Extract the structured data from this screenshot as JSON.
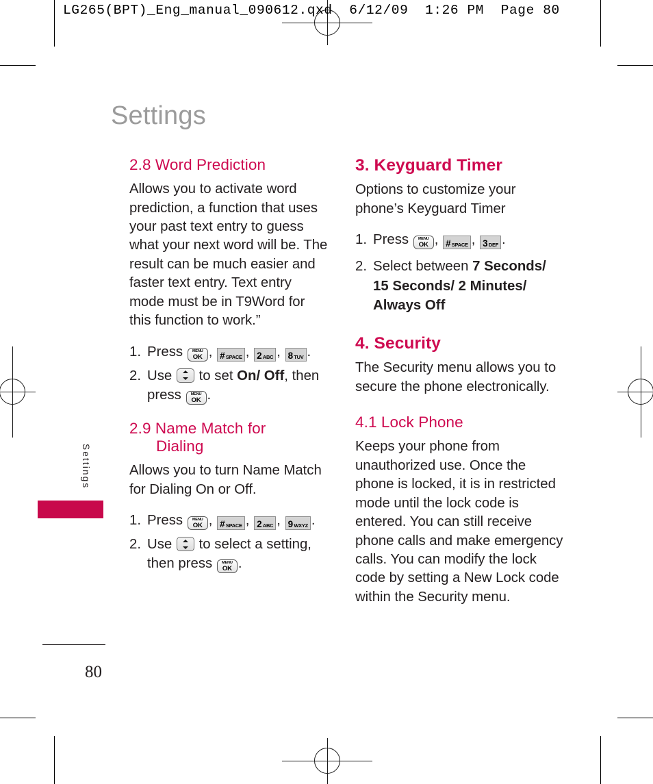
{
  "prepress": {
    "slug": "LG265(BPT)_Eng_manual_090612.qxd  6/12/09  1:26 PM  Page 80"
  },
  "page": {
    "title": "Settings",
    "side_tab_label": "Settings",
    "number": "80",
    "accent_color": "#ce0a50",
    "tab_color": "#c8094b",
    "title_color": "#9b9b9b"
  },
  "left_column": {
    "sections": [
      {
        "heading": "2.8 Word Prediction",
        "body": "Allows you to activate word prediction, a function that uses your past text entry to guess what your next word will be. The result can be much easier and faster text entry. Text entry mode must be in T9Word for this function to work.”",
        "steps": [
          {
            "num": "1.",
            "pre": "Press",
            "keys": [
              "MENU OK",
              "# SPACE",
              "2 ABC",
              "8 TUV"
            ],
            "post": "."
          },
          {
            "num": "2.",
            "pre": "Use",
            "nav_key": "up-down-navigation",
            "mid": "to set",
            "bold": "On/ Off",
            "after": ", then press",
            "end_key": "MENU OK",
            "post": "."
          }
        ]
      },
      {
        "heading_line1": "2.9 Name Match for",
        "heading_line2": "Dialing",
        "body": "Allows you to turn Name Match for Dialing On or Off.",
        "steps": [
          {
            "num": "1.",
            "pre": "Press",
            "keys": [
              "MENU OK",
              "# SPACE",
              "2 ABC",
              "9 WXYZ"
            ],
            "post": "."
          },
          {
            "num": "2.",
            "pre": "Use",
            "nav_key": "up-down-navigation",
            "mid": "to select a setting, then press",
            "end_key": "MENU OK",
            "post": "."
          }
        ]
      }
    ]
  },
  "right_column": {
    "sections": [
      {
        "heading": "3. Keyguard Timer",
        "body": "Options to customize your phone’s Keyguard Timer",
        "steps": [
          {
            "num": "1.",
            "pre": "Press",
            "keys": [
              "MENU OK",
              "# SPACE",
              "3 DEF"
            ],
            "post": "."
          },
          {
            "num": "2.",
            "pre": "Select between",
            "bold_line1": "7 Seconds/",
            "bold_line2": "15 Seconds/ 2 Minutes/",
            "bold_line3": "Always Off"
          }
        ]
      },
      {
        "heading": "4. Security",
        "body": "The Security menu allows you to secure the phone electronically."
      },
      {
        "subheading": "4.1 Lock Phone",
        "body": "Keeps your phone from unauthorized use. Once the phone is locked, it is in restricted mode until the lock code is entered. You can still receive phone calls and make emergency calls. You can modify the lock code by setting a New Lock code within the Security menu."
      }
    ]
  },
  "keys": {
    "ok": {
      "line1": "MENU",
      "line2": "OK"
    },
    "hash": {
      "big": "#",
      "small": "SPACE"
    },
    "two": {
      "big": "2",
      "small": "ABC"
    },
    "three": {
      "big": "3",
      "small": "DEF"
    },
    "eight": {
      "big": "8",
      "small": "TUV"
    },
    "nine": {
      "big": "9",
      "small": "WXYZ"
    }
  },
  "separators": {
    "comma": ",",
    "period": "."
  }
}
